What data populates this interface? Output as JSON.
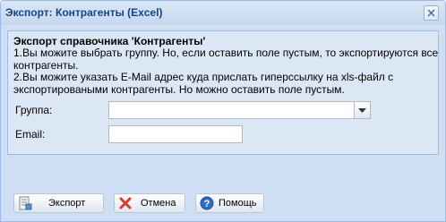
{
  "window": {
    "title": "Экспорт: Контрагенты (Excel)"
  },
  "form": {
    "heading": "Экспорт справочника 'Контрагенты'",
    "description_lines": [
      "1.Вы можите выбрать группу. Но, если оставить поле пустым, то экспортируются все контрагенты.",
      "2.Вы можите указать E-Mail адрес куда прислать гиперссылку на xls-файл с экспортироваными контрагенты. Но можно оставить поле пустым."
    ],
    "group_label": "Группа:",
    "group_value": "",
    "email_label": "Email:",
    "email_value": ""
  },
  "buttons": {
    "export": "Экспорт",
    "cancel": "Отмена",
    "help": "Помощь"
  },
  "colors": {
    "title_text": "#15428b",
    "window_bg": "#cfdff3",
    "panel_bg": "#dbe7f5",
    "cancel_icon": "#d63b2f",
    "help_icon": "#2c6fc2"
  }
}
